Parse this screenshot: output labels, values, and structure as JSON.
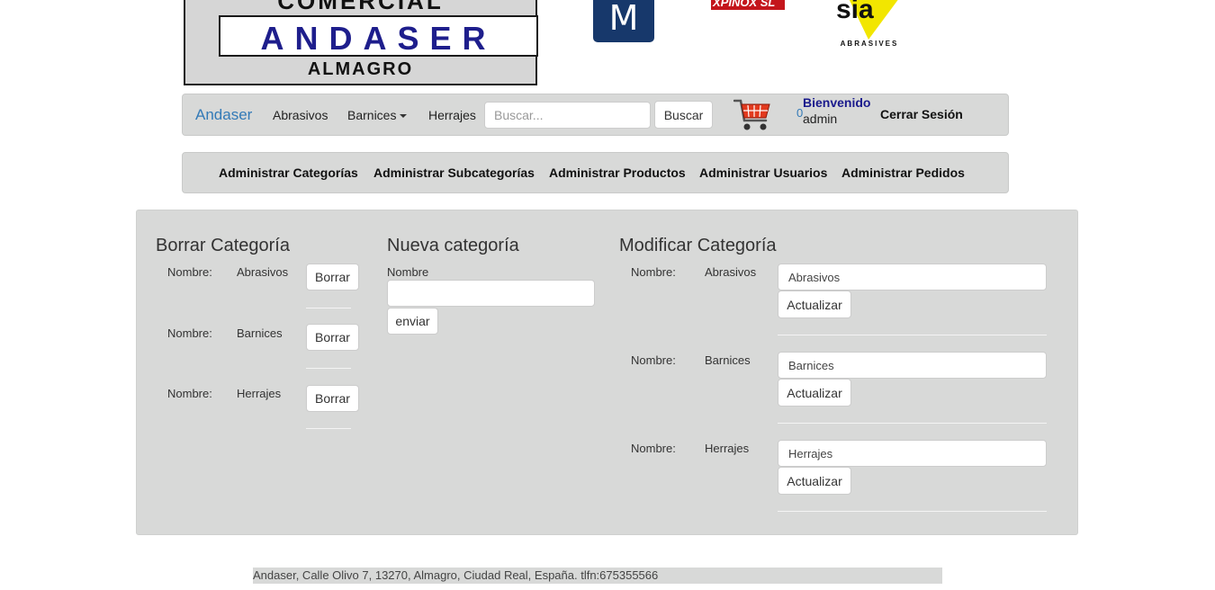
{
  "logos": {
    "main": {
      "line1": "COMERCIAL",
      "line2": "ANDASER",
      "line3": "ALMAGRO"
    },
    "m_logo": "M",
    "red_logo": "XPINOX SL",
    "sia_logo": {
      "mark": "sia",
      "tagline": "ABRASIVES"
    }
  },
  "navbar": {
    "brand": "Andaser",
    "links": [
      {
        "label": "Abrasivos"
      },
      {
        "label": "Barnices"
      },
      {
        "label": "Herrajes"
      }
    ],
    "search_placeholder": "Buscar...",
    "search_button": "Buscar",
    "cart_count": "0",
    "welcome": "Bienvenido",
    "username": "admin",
    "logout": "Cerrar Sesión"
  },
  "admin_menu": {
    "items": [
      {
        "label": "Administrar Categorías"
      },
      {
        "label": "Administrar Subcategorías"
      },
      {
        "label": "Administrar Productos"
      },
      {
        "label": "Administrar Usuarios"
      },
      {
        "label": "Administrar Pedidos"
      }
    ]
  },
  "delete_section": {
    "title": "Borrar Categoría",
    "rows": [
      {
        "label": "Nombre:",
        "name": "Abrasivos",
        "button": "Borrar"
      },
      {
        "label": "Nombre:",
        "name": "Barnices",
        "button": "Borrar"
      },
      {
        "label": "Nombre:",
        "name": "Herrajes",
        "button": "Borrar"
      }
    ]
  },
  "new_section": {
    "title": "Nueva categoría",
    "field_label": "Nombre",
    "field_value": "",
    "button": "enviar"
  },
  "modify_section": {
    "title": "Modificar Categoría",
    "rows": [
      {
        "label": "Nombre:",
        "name": "Abrasivos",
        "value": "Abrasivos",
        "button": "Actualizar"
      },
      {
        "label": "Nombre:",
        "name": "Barnices",
        "value": "Barnices",
        "button": "Actualizar"
      },
      {
        "label": "Nombre:",
        "name": "Herrajes",
        "value": "Herrajes",
        "button": "Actualizar"
      }
    ]
  },
  "footer": {
    "text": "Andaser, Calle Olivo 7, 13270, Almagro, Ciudad Real, España. tlfn:675355566"
  },
  "colors": {
    "brand_blue": "#337ab7",
    "panel_gray": "#d8d9d8",
    "welcome_navy": "#1a1a8c",
    "logo_navy": "#1e1e8c"
  }
}
